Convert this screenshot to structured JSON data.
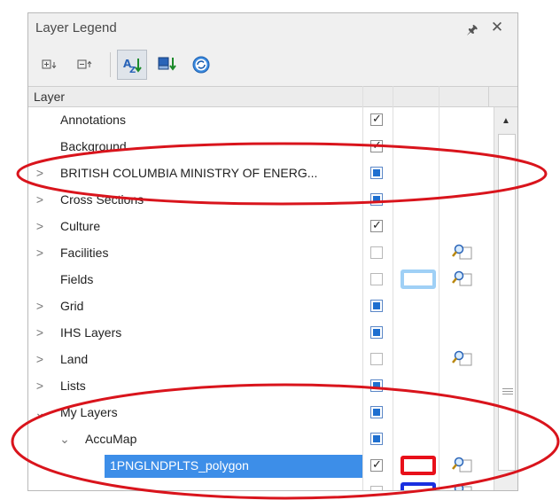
{
  "panel": {
    "title": "Layer Legend",
    "pin_icon": "pin-icon",
    "close_icon": "close-icon"
  },
  "toolbar": {
    "buttons": [
      {
        "icon": "expand-all-icon",
        "active": false
      },
      {
        "icon": "collapse-all-icon",
        "active": false
      },
      {
        "icon": "sort-az-icon",
        "active": true
      },
      {
        "icon": "layer-down-icon",
        "active": false
      },
      {
        "icon": "refresh-icon",
        "active": false
      }
    ]
  },
  "header": {
    "column_layer": "Layer"
  },
  "rows": [
    {
      "name": "Annotations",
      "expander": "",
      "checkbox": "checked",
      "swatch": "",
      "legend": false,
      "selected": false
    },
    {
      "name": "Background",
      "expander": "",
      "checkbox": "checked",
      "swatch": "",
      "legend": false,
      "selected": false
    },
    {
      "name": "BRITISH COLUMBIA MINISTRY OF ENERG...",
      "expander": ">",
      "checkbox": "partial",
      "swatch": "",
      "legend": false,
      "selected": false
    },
    {
      "name": "Cross Sections",
      "expander": ">",
      "checkbox": "partial",
      "swatch": "",
      "legend": false,
      "selected": false
    },
    {
      "name": "Culture",
      "expander": ">",
      "checkbox": "checked",
      "swatch": "",
      "legend": false,
      "selected": false
    },
    {
      "name": "Facilities",
      "expander": ">",
      "checkbox": "empty",
      "swatch": "",
      "legend": true,
      "selected": false
    },
    {
      "name": "Fields",
      "expander": "",
      "checkbox": "empty",
      "swatch": "#9fd0f6",
      "legend": true,
      "selected": false
    },
    {
      "name": "Grid",
      "expander": ">",
      "checkbox": "partial",
      "swatch": "",
      "legend": false,
      "selected": false
    },
    {
      "name": "IHS Layers",
      "expander": ">",
      "checkbox": "partial",
      "swatch": "",
      "legend": false,
      "selected": false
    },
    {
      "name": "Land",
      "expander": ">",
      "checkbox": "empty",
      "swatch": "",
      "legend": true,
      "selected": false
    },
    {
      "name": "Lists",
      "expander": ">",
      "checkbox": "partial",
      "swatch": "",
      "legend": false,
      "selected": false
    },
    {
      "name": "My Layers",
      "expander": "⌄",
      "checkbox": "partial",
      "swatch": "",
      "legend": false,
      "selected": false
    },
    {
      "name": "AccuMap",
      "expander": "⌄",
      "checkbox": "partial",
      "swatch": "",
      "legend": false,
      "selected": false
    },
    {
      "name": "1PNGLNDPLTS_polygon",
      "expander": "",
      "checkbox": "checked",
      "swatch": "#e8101a",
      "legend": true,
      "selected": true
    },
    {
      "name": "",
      "expander": "",
      "checkbox": "empty",
      "swatch": "#1a2fe0",
      "legend": true,
      "selected": false
    }
  ],
  "colors": {
    "selection": "#3d8ee8",
    "annotation_circle": "#d9141c",
    "checkbox_fill": "#1e6fd0"
  }
}
